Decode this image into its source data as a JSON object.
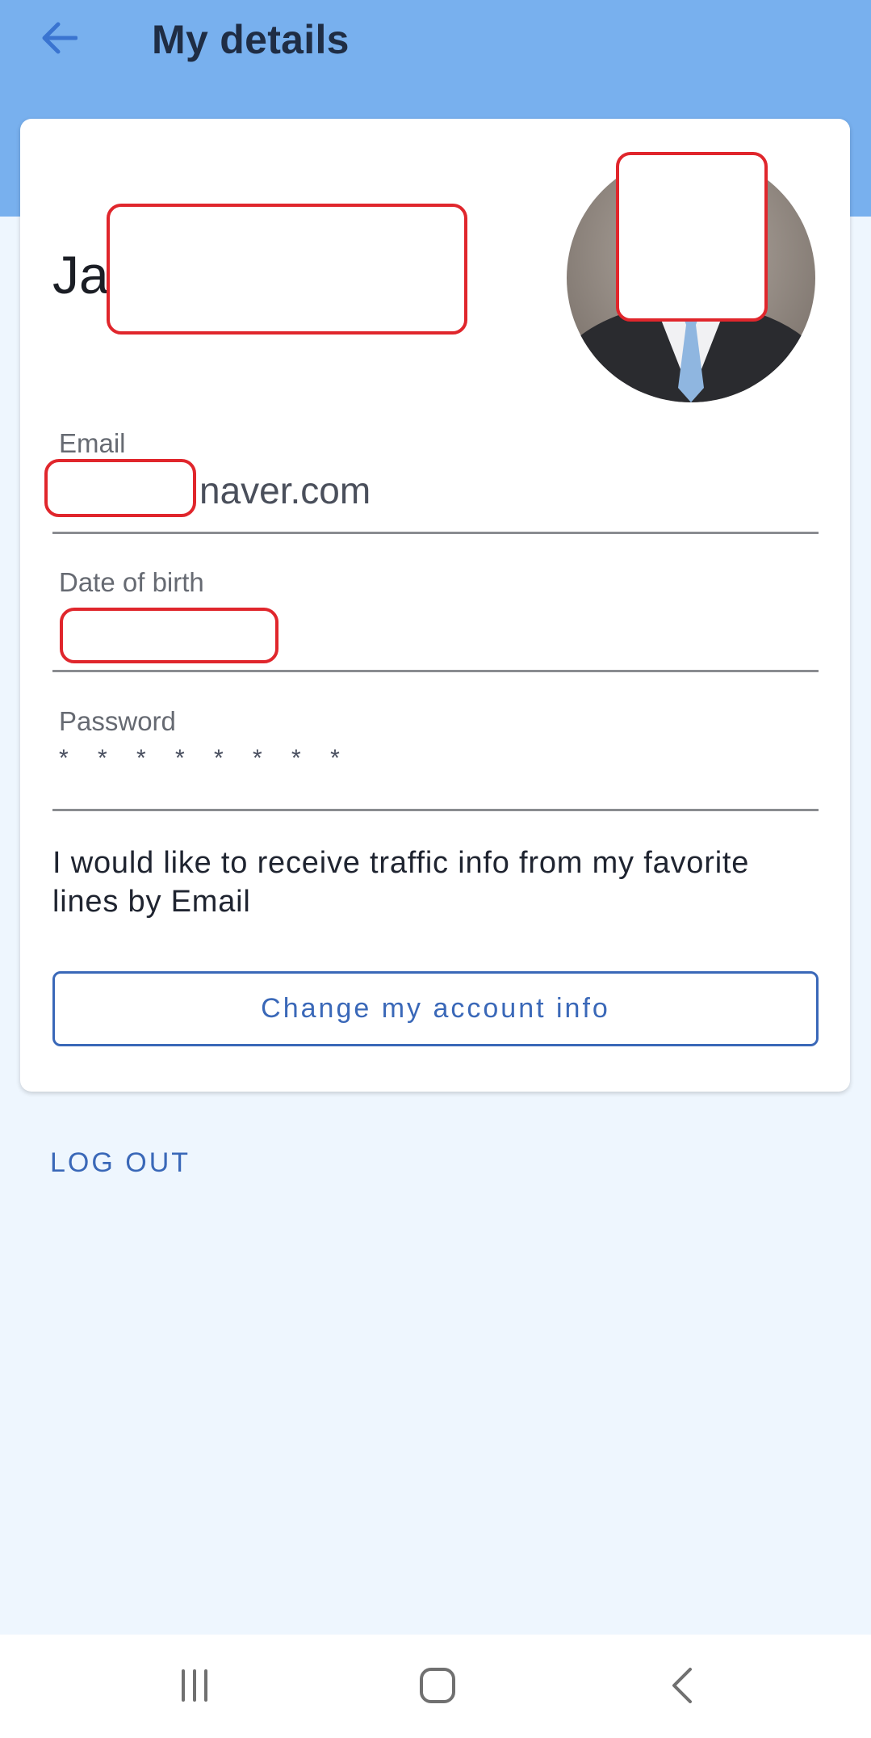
{
  "header": {
    "title": "My details",
    "back_icon": "arrow-left-icon"
  },
  "profile": {
    "name_visible": "Ja",
    "avatar_icon": "profile-photo"
  },
  "fields": {
    "email": {
      "label": "Email",
      "value_visible": "naver.com"
    },
    "dob": {
      "label": "Date of birth",
      "value_visible": ""
    },
    "password": {
      "label": "Password",
      "value": "* * * * * * * *"
    }
  },
  "optin_text": "I would like to receive traffic info from my favorite lines by Email",
  "change_button_label": "Change my account info",
  "logout_label": "LOG OUT",
  "nav": {
    "recents_icon": "recents-icon",
    "home_icon": "home-icon",
    "back_icon": "back-chevron-icon"
  },
  "colors": {
    "header": "#78b0ee",
    "background": "#eef6fe",
    "accent": "#3a68b8",
    "redaction": "#e0262c"
  }
}
